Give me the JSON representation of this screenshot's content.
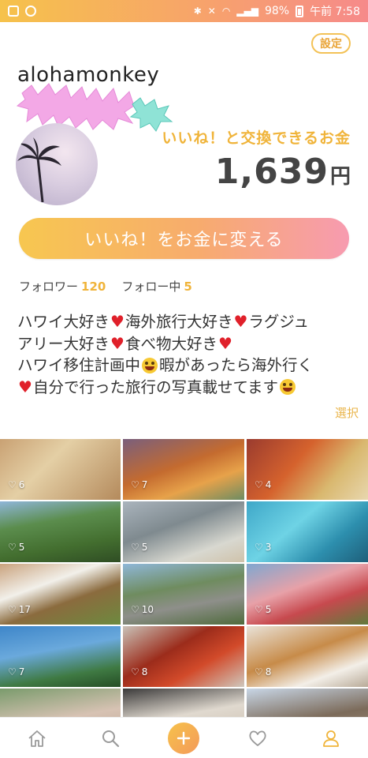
{
  "status_bar": {
    "battery": "98%",
    "time": "午前 7:58"
  },
  "header": {
    "settings_label": "設定",
    "username": "alohamonkey"
  },
  "wallet": {
    "exchange_label": "いいね！と交換できるお金",
    "balance": "1,639",
    "unit": "円",
    "convert_button_label": "いいね！をお金に変える"
  },
  "follow": {
    "followers_label": "フォロワー",
    "followers_count": "120",
    "following_label": "フォロー中",
    "following_count": "5"
  },
  "bio": {
    "line1": [
      "ハワイ大好き",
      "海外旅行大好き",
      "ラグジュ"
    ],
    "line2": [
      "アリー大好き",
      "食べ物大好き"
    ],
    "line3": [
      "ハワイ移住計画中",
      "暇があったら海外行く"
    ],
    "line4": [
      "自分で行った旅行の写真載せてます"
    ]
  },
  "select_label": "選択",
  "posts": [
    {
      "likes": "6"
    },
    {
      "likes": "7"
    },
    {
      "likes": "4"
    },
    {
      "likes": "5"
    },
    {
      "likes": "5"
    },
    {
      "likes": "3"
    },
    {
      "likes": "17"
    },
    {
      "likes": "10"
    },
    {
      "likes": "5"
    },
    {
      "likes": "7"
    },
    {
      "likes": "8"
    },
    {
      "likes": "8"
    },
    {
      "likes": ""
    },
    {
      "likes": ""
    },
    {
      "likes": ""
    }
  ],
  "colors": {
    "accent_orange": "#f0b43a",
    "gradient_start": "#f7c750",
    "gradient_end": "#f79bb0",
    "heart_red": "#e0202a"
  },
  "nav": {
    "icons": [
      "home-icon",
      "search-icon",
      "add-icon",
      "heart-icon",
      "profile-icon"
    ]
  }
}
